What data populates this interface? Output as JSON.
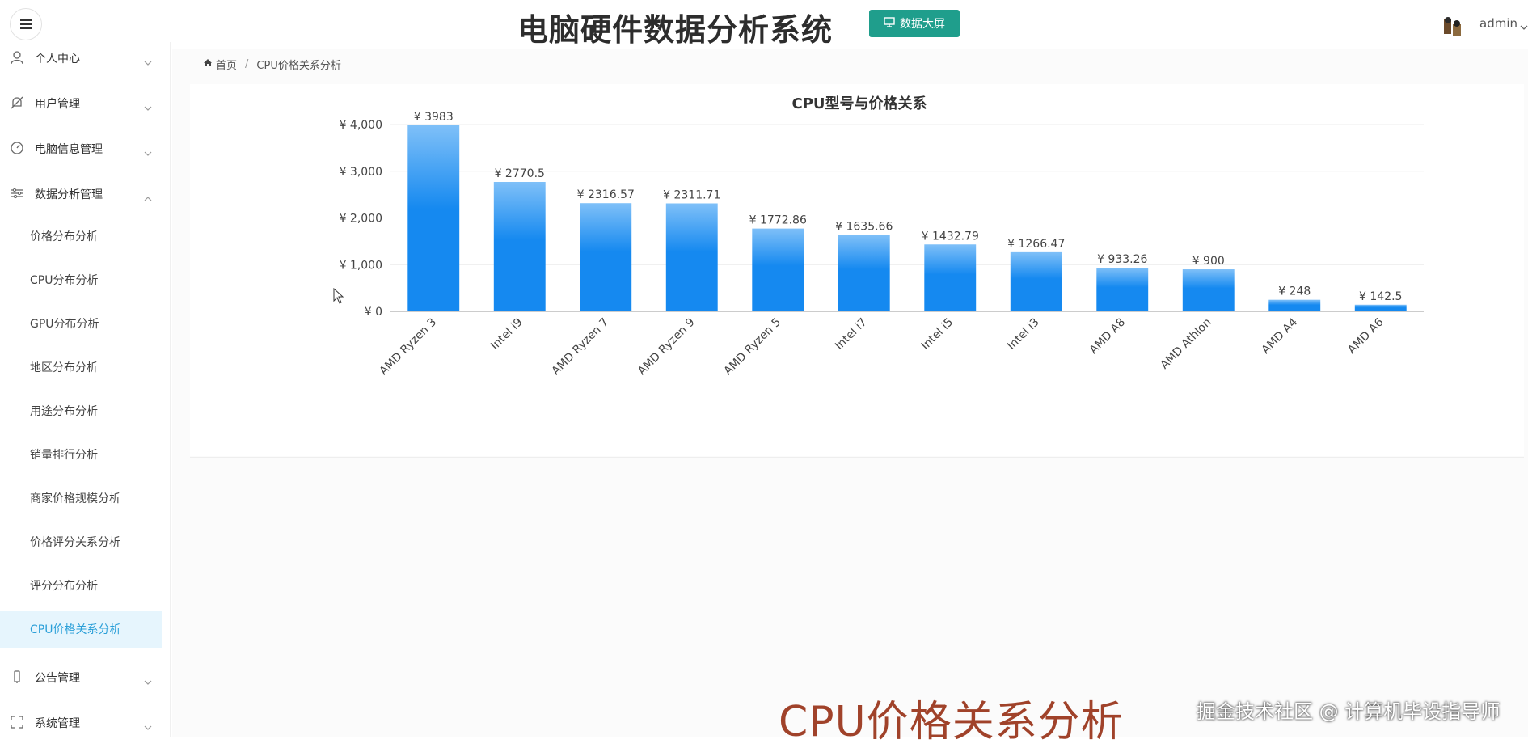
{
  "header": {
    "title": "电脑硬件数据分析系统",
    "bigscreen_label": "数据大屏",
    "username": "admin"
  },
  "sidebar": {
    "items": [
      {
        "label": "个人中心",
        "icon": "user-icon"
      },
      {
        "label": "用户管理",
        "icon": "bell-off-icon"
      },
      {
        "label": "电脑信息管理",
        "icon": "gauge-icon"
      },
      {
        "label": "数据分析管理",
        "icon": "sliders-icon"
      }
    ],
    "sub_items": [
      {
        "label": "价格分布分析"
      },
      {
        "label": "CPU分布分析"
      },
      {
        "label": "GPU分布分析"
      },
      {
        "label": "地区分布分析"
      },
      {
        "label": "用途分布分析"
      },
      {
        "label": "销量排行分析"
      },
      {
        "label": "商家价格规模分析"
      },
      {
        "label": "价格评分关系分析"
      },
      {
        "label": "评分分布分析"
      },
      {
        "label": "CPU价格关系分析",
        "active": true
      }
    ],
    "bottom_items": [
      {
        "label": "公告管理",
        "icon": "phone-icon"
      },
      {
        "label": "系统管理",
        "icon": "frame-icon"
      }
    ]
  },
  "breadcrumb": {
    "home": "首页",
    "current": "CPU价格关系分析"
  },
  "caption": "CPU价格关系分析",
  "watermark": "掘金技术社区 @ 计算机毕设指导师",
  "colors": {
    "accent": "#1f9e8c",
    "bar_top": "#7fc0f8",
    "bar_bottom": "#1589f0",
    "active_bg": "#e6f5fd",
    "active_text": "#2a9fd8"
  },
  "chart_data": {
    "type": "bar",
    "title": "CPU型号与价格关系",
    "categories": [
      "AMD Ryzen 3",
      "Intel i9",
      "AMD Ryzen 7",
      "AMD Ryzen 9",
      "AMD Ryzen 5",
      "Intel i7",
      "Intel i5",
      "Intel i3",
      "AMD A8",
      "AMD Athlon",
      "AMD A4",
      "AMD A6"
    ],
    "values": [
      3983,
      2770.5,
      2316.57,
      2311.71,
      1772.86,
      1635.66,
      1432.79,
      1266.47,
      933.26,
      900,
      248,
      142.5
    ],
    "data_labels": [
      "¥ 3983",
      "¥ 2770.5",
      "¥ 2316.57",
      "¥ 2311.71",
      "¥ 1772.86",
      "¥ 1635.66",
      "¥ 1432.79",
      "¥ 1266.47",
      "¥ 933.26",
      "¥ 900",
      "¥ 248",
      "¥ 142.5"
    ],
    "ylim": [
      0,
      4000
    ],
    "yticks": [
      0,
      1000,
      2000,
      3000,
      4000
    ],
    "ytick_labels": [
      "¥ 0",
      "¥ 1,000",
      "¥ 2,000",
      "¥ 3,000",
      "¥ 4,000"
    ],
    "grid": true,
    "xlabel": "",
    "ylabel": ""
  }
}
